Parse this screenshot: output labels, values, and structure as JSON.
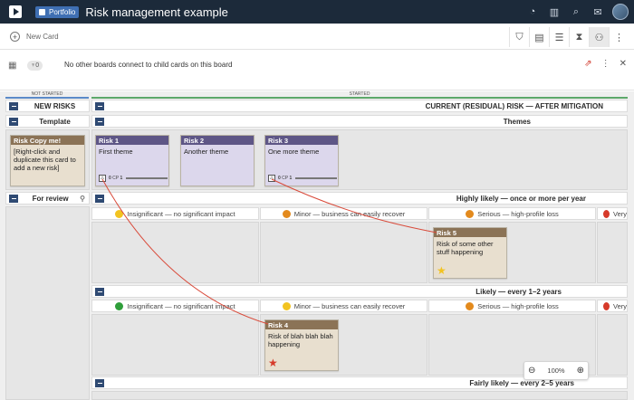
{
  "topbar": {
    "portfolio_label": "Portfolio",
    "title": "Risk management example",
    "icons": [
      "logo-icon",
      "globe-icon",
      "chart-icon",
      "search-icon",
      "notifications-icon",
      "avatar"
    ]
  },
  "toolbar": {
    "new_card_label": "New Card",
    "buttons": [
      "filter-icon",
      "card-list-icon",
      "checklist-icon",
      "hourglass-icon",
      "hierarchy-icon",
      "more-icon"
    ]
  },
  "infobar": {
    "badge_count": "0",
    "message": "No other boards connect to child cards on this board"
  },
  "phases": {
    "not_started": "NOT STARTED",
    "started": "STARTED"
  },
  "columns": {
    "new_risks": "NEW RISKS",
    "current": "CURRENT (RESIDUAL) RISK — AFTER MITIGATION",
    "template": "Template",
    "themes": "Themes",
    "for_review": "For review"
  },
  "lanes": {
    "highly_likely": "Highly likely — once or more per year",
    "likely": "Likely — every 1–2 years",
    "fairly_likely": "Fairly likely — every 2–5 years"
  },
  "impacts": {
    "insignificant": "Insignificant — no significant impact",
    "minor": "Minor — business can easily recover",
    "serious": "Serious — high-profile loss",
    "very": "Very"
  },
  "colors": {
    "insignificant_hl": "#f2c320",
    "insignificant_l": "#2f9e3a",
    "minor_hl": "#e38a1d",
    "minor_l": "#f2c320",
    "serious": "#e38a1d",
    "very": "#d63a2a"
  },
  "cards": {
    "template": {
      "title": "Risk Copy me!",
      "body": "[Right-click and duplicate this card to add a new risk]"
    },
    "risk1": {
      "title": "Risk 1",
      "body": "First theme",
      "count_a": "0",
      "count_b": "1"
    },
    "risk2": {
      "title": "Risk 2",
      "body": "Another theme"
    },
    "risk3": {
      "title": "Risk 3",
      "body": "One more theme",
      "count_a": "0",
      "count_b": "1"
    },
    "risk5": {
      "title": "Risk 5",
      "body": "Risk of some other stuff happening"
    },
    "risk4": {
      "title": "Risk 4",
      "body": "Risk of blah blah blah happening"
    }
  },
  "zoom": {
    "level": "100%"
  }
}
